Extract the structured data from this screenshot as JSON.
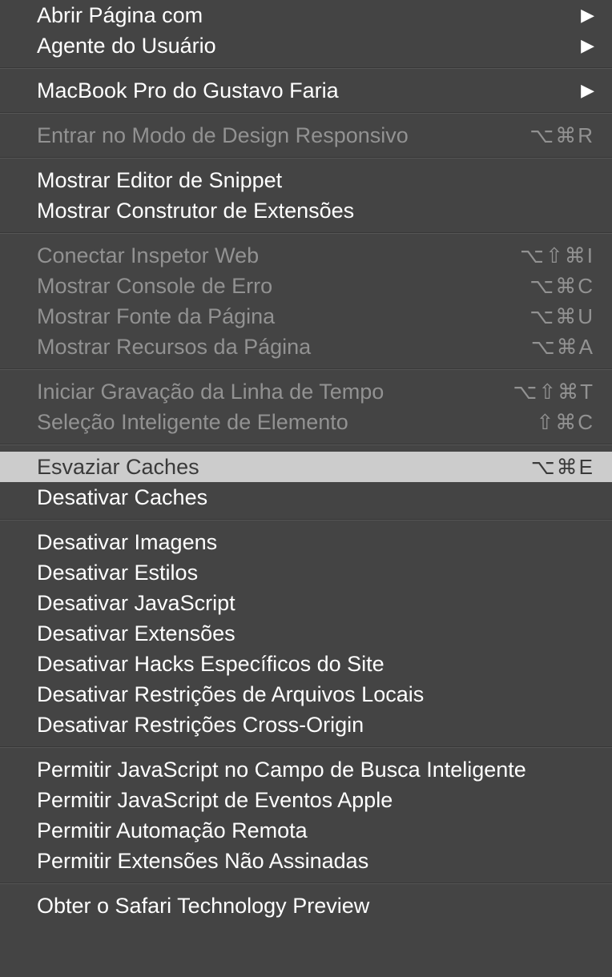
{
  "menu": {
    "groups": [
      {
        "items": [
          {
            "label": "Abrir Página com",
            "disabled": false,
            "submenu": true,
            "shortcut": ""
          },
          {
            "label": "Agente do Usuário",
            "disabled": false,
            "submenu": true,
            "shortcut": ""
          }
        ]
      },
      {
        "items": [
          {
            "label": "MacBook Pro do Gustavo Faria",
            "disabled": false,
            "submenu": true,
            "shortcut": ""
          }
        ]
      },
      {
        "items": [
          {
            "label": "Entrar no Modo de Design Responsivo",
            "disabled": true,
            "submenu": false,
            "shortcut": "⌥⌘R"
          }
        ]
      },
      {
        "items": [
          {
            "label": "Mostrar Editor de Snippet",
            "disabled": false,
            "submenu": false,
            "shortcut": ""
          },
          {
            "label": "Mostrar Construtor de Extensões",
            "disabled": false,
            "submenu": false,
            "shortcut": ""
          }
        ]
      },
      {
        "items": [
          {
            "label": "Conectar Inspetor Web",
            "disabled": true,
            "submenu": false,
            "shortcut": "⌥⇧⌘I"
          },
          {
            "label": "Mostrar Console de Erro",
            "disabled": true,
            "submenu": false,
            "shortcut": "⌥⌘C"
          },
          {
            "label": "Mostrar Fonte da Página",
            "disabled": true,
            "submenu": false,
            "shortcut": "⌥⌘U"
          },
          {
            "label": "Mostrar Recursos da Página",
            "disabled": true,
            "submenu": false,
            "shortcut": "⌥⌘A"
          }
        ]
      },
      {
        "items": [
          {
            "label": "Iniciar Gravação da Linha de Tempo",
            "disabled": true,
            "submenu": false,
            "shortcut": "⌥⇧⌘T"
          },
          {
            "label": "Seleção Inteligente de Elemento",
            "disabled": true,
            "submenu": false,
            "shortcut": "⇧⌘C"
          }
        ]
      },
      {
        "items": [
          {
            "label": "Esvaziar Caches",
            "disabled": false,
            "submenu": false,
            "shortcut": "⌥⌘E",
            "highlighted": true
          },
          {
            "label": "Desativar Caches",
            "disabled": false,
            "submenu": false,
            "shortcut": ""
          }
        ]
      },
      {
        "items": [
          {
            "label": "Desativar Imagens",
            "disabled": false,
            "submenu": false,
            "shortcut": ""
          },
          {
            "label": "Desativar Estilos",
            "disabled": false,
            "submenu": false,
            "shortcut": ""
          },
          {
            "label": "Desativar JavaScript",
            "disabled": false,
            "submenu": false,
            "shortcut": ""
          },
          {
            "label": "Desativar Extensões",
            "disabled": false,
            "submenu": false,
            "shortcut": ""
          },
          {
            "label": "Desativar Hacks Específicos do Site",
            "disabled": false,
            "submenu": false,
            "shortcut": ""
          },
          {
            "label": "Desativar Restrições de Arquivos Locais",
            "disabled": false,
            "submenu": false,
            "shortcut": ""
          },
          {
            "label": "Desativar Restrições Cross-Origin",
            "disabled": false,
            "submenu": false,
            "shortcut": ""
          }
        ]
      },
      {
        "items": [
          {
            "label": "Permitir JavaScript no Campo de Busca Inteligente",
            "disabled": false,
            "submenu": false,
            "shortcut": ""
          },
          {
            "label": "Permitir JavaScript de Eventos Apple",
            "disabled": false,
            "submenu": false,
            "shortcut": ""
          },
          {
            "label": "Permitir Automação Remota",
            "disabled": false,
            "submenu": false,
            "shortcut": ""
          },
          {
            "label": "Permitir Extensões Não Assinadas",
            "disabled": false,
            "submenu": false,
            "shortcut": ""
          }
        ]
      },
      {
        "items": [
          {
            "label": "Obter o Safari Technology Preview",
            "disabled": false,
            "submenu": false,
            "shortcut": ""
          }
        ]
      }
    ]
  }
}
